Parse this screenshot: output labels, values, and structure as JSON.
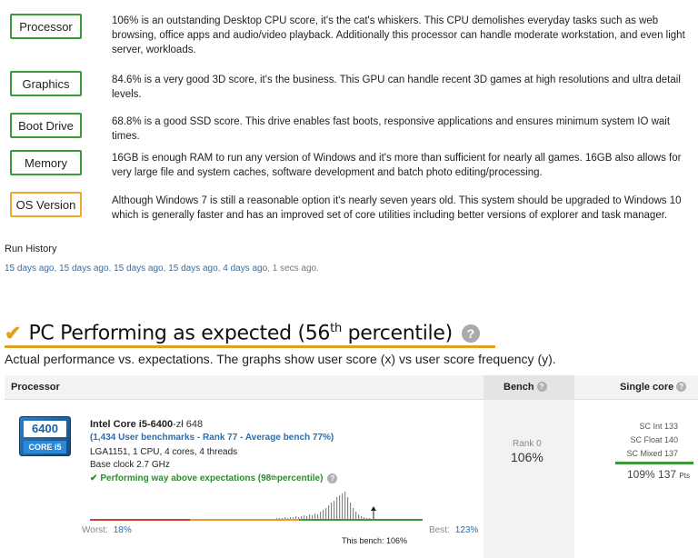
{
  "summary": [
    {
      "badge": "Processor",
      "status": "good",
      "text": "106% is an outstanding Desktop CPU score, it's the cat's whiskers. This CPU demolishes everyday tasks such as web browsing, office apps and audio/video playback. Additionally this processor can handle moderate workstation, and even light server, workloads."
    },
    {
      "badge": "Graphics",
      "status": "good",
      "text": "84.6% is a very good 3D score, it's the business. This GPU can handle recent 3D games at high resolutions and ultra detail levels."
    },
    {
      "badge": "Boot Drive",
      "status": "good",
      "text": "68.8% is a good SSD score. This drive enables fast boots, responsive applications and ensures minimum system IO wait times."
    },
    {
      "badge": "Memory",
      "status": "good",
      "text": "16GB is enough RAM to run any version of Windows and it's more than sufficient for nearly all games. 16GB also allows for very large file and system caches, software development and batch photo editing/processing."
    },
    {
      "badge": "OS Version",
      "status": "warning",
      "text": "Although Windows 7 is still a reasonable option it's nearly seven years old. This system should be upgraded to Windows 10 which is generally faster and has an improved set of core utilities including better versions of explorer and task manager."
    }
  ],
  "run_history": {
    "label": "Run History",
    "links": [
      "15 days ago",
      "15 days ago",
      "15 days ago",
      "15 days ago",
      "4 days ago"
    ],
    "current": "1 secs ago."
  },
  "verdict": {
    "title_prefix": "PC Performing as expected (56",
    "title_sup": "th",
    "title_suffix": " percentile)",
    "subtitle": "Actual performance vs. expectations. The graphs show user score (x) vs user score frequency (y)."
  },
  "table": {
    "col_processor": "Processor",
    "col_bench": "Bench",
    "col_single": "Single core"
  },
  "cpu": {
    "logo_top": "6400",
    "logo_bottom": "CORE i5",
    "name": "Intel Core i5-6400",
    "price": "-zł 648",
    "bench_link": "(1,434 User benchmarks - Rank 77 - Average bench 77%)",
    "socket_line": "LGA1151, 1 CPU, 4 cores, 4 threads",
    "clock_line": "Base clock 2.7 GHz",
    "perf_text": "Performing way above expectations (98",
    "perf_sup": "th",
    "perf_suffix": " percentile)",
    "worst_label": "Worst:",
    "worst_value": "18%",
    "best_label": "Best:",
    "best_value": "123%",
    "this_bench": "This bench: 106%",
    "rank_label": "Rank 0",
    "rank_value": "106%",
    "sc_int": "SC Int 133",
    "sc_float": "SC Float 140",
    "sc_mixed": "SC Mixed 137",
    "sc_result": "109% 137",
    "sc_unit": "Pts"
  },
  "colors": {
    "good_border": "#3a9a3a",
    "warn_border": "#f0a830",
    "accent": "#e3a020",
    "link": "#2a6fb0"
  }
}
